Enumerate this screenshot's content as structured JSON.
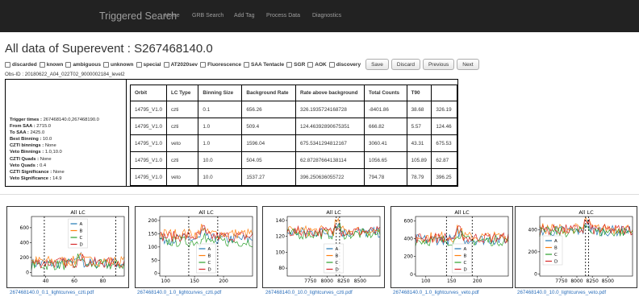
{
  "nav": {
    "brand": "Triggered Search",
    "links": [
      "Home",
      "GRB Search",
      "Add Tag",
      "Process Data",
      "Diagnostics"
    ]
  },
  "title": "All data of Superevent : S267468140.0",
  "checkboxes": [
    "discarded",
    "known",
    "ambiguous",
    "unknown",
    "special",
    "AT2020sev",
    "Fluorescence",
    "SAA Tentacle",
    "SGR",
    "AOK",
    "discovery"
  ],
  "buttons": [
    "Save",
    "Discard",
    "Previous",
    "Next"
  ],
  "obs_id": "Obs-ID : 20180622_A04_022T02_9000002184_level2",
  "info": [
    {
      "label": "Trigger times :",
      "value": "267468140.0,267468190.0"
    },
    {
      "label": "From SAA :",
      "value": "2715.0"
    },
    {
      "label": "To SAA :",
      "value": "2425.0"
    },
    {
      "label": "Best Binning :",
      "value": "10.0"
    },
    {
      "label": "CZTI binnings :",
      "value": "None"
    },
    {
      "label": "Veto Binnings :",
      "value": "1.0,10.0"
    },
    {
      "label": "CZTI Quads :",
      "value": "None"
    },
    {
      "label": "Veto Quads :",
      "value": "0.4"
    },
    {
      "label": "CZTI Significance :",
      "value": "None"
    },
    {
      "label": "Veto Significance :",
      "value": "14.9"
    }
  ],
  "table": {
    "headers": [
      "Orbit",
      "LC Type",
      "Binning Size",
      "Background Rate",
      "Rate above background",
      "Total Counts",
      "T90",
      ""
    ],
    "rows": [
      [
        "14795_V1.0",
        "czti",
        "0.1",
        "656.26",
        "326.1935724168728",
        "-8401.86",
        "38.68",
        "326.19"
      ],
      [
        "14795_V1.0",
        "czti",
        "1.0",
        "509.4",
        "124.46392890675351",
        "666.82",
        "5.57",
        "124.46"
      ],
      [
        "14795_V1.0",
        "veto",
        "1.0",
        "1596.04",
        "675.5341294812167",
        "3060.41",
        "43.31",
        "675.53"
      ],
      [
        "14795_V1.0",
        "czti",
        "10.0",
        "504.05",
        "62.87287664138114",
        "1056.65",
        "105.89",
        "62.87"
      ],
      [
        "14795_V1.0",
        "veto",
        "10.0",
        "1537.27",
        "396.250636055722",
        "794.78",
        "78.79",
        "396.25"
      ]
    ]
  },
  "legend": [
    "A",
    "B",
    "C",
    "D"
  ],
  "colors": {
    "A": "#1f77b4",
    "B": "#ff7f0e",
    "C": "#2ca02c",
    "D": "#d62728"
  },
  "chart_data": [
    {
      "type": "line",
      "title": "All LC",
      "file": "267468140.0_0.1_lightcurves_czti.pdf",
      "xlim": [
        30,
        95
      ],
      "ylim": [
        -50,
        750
      ],
      "xticks": [
        40,
        60,
        80
      ],
      "yticks": [
        0,
        200,
        400,
        600
      ],
      "levels": [
        120,
        150,
        100,
        130
      ],
      "markers": [
        39,
        89
      ],
      "legend_pos": "top-center"
    },
    {
      "type": "line",
      "title": "All LC",
      "file": "267468140.0_1.0_lightcurves_czti.pdf",
      "xlim": [
        90,
        250
      ],
      "ylim": [
        -10,
        215
      ],
      "xticks": [
        100,
        150,
        200
      ],
      "yticks": [
        0,
        50,
        100,
        150,
        200
      ],
      "levels": [
        130,
        150,
        120,
        140
      ],
      "markers": [
        140,
        190
      ],
      "legend_pos": "bottom-center"
    },
    {
      "type": "line",
      "title": "All LC",
      "file": "267468140.0_10.0_lightcurves_czti.pdf",
      "xlim": [
        7400,
        8800
      ],
      "ylim": [
        70,
        145
      ],
      "xticks": [
        7750,
        8000,
        8250,
        8500
      ],
      "yticks": [
        80,
        100,
        120,
        140
      ],
      "levels": [
        125,
        127,
        123,
        126
      ],
      "markers": [
        8140,
        8190
      ],
      "legend_pos": "bottom-center"
    },
    {
      "type": "line",
      "title": "All LC",
      "file": "267468140.0_1.0_lightcurves_veto.pdf",
      "xlim": [
        80,
        260
      ],
      "ylim": [
        -20,
        650
      ],
      "xticks": [
        100,
        150,
        200
      ],
      "yticks": [
        0,
        200,
        400,
        600
      ],
      "levels": [
        390,
        420,
        380,
        410
      ],
      "markers": [
        140,
        190
      ],
      "legend_pos": "bottom-center"
    },
    {
      "type": "line",
      "title": "All LC",
      "file": "267468140.0_10.0_lightcurves_veto.pdf",
      "xlim": [
        7400,
        8900
      ],
      "ylim": [
        -20,
        520
      ],
      "xticks": [
        7750,
        8000,
        8250,
        8500
      ],
      "yticks": [
        0,
        200,
        400
      ],
      "levels": [
        390,
        410,
        380,
        400
      ],
      "markers": [
        8140,
        8190
      ],
      "legend_pos": "middle-left"
    }
  ]
}
